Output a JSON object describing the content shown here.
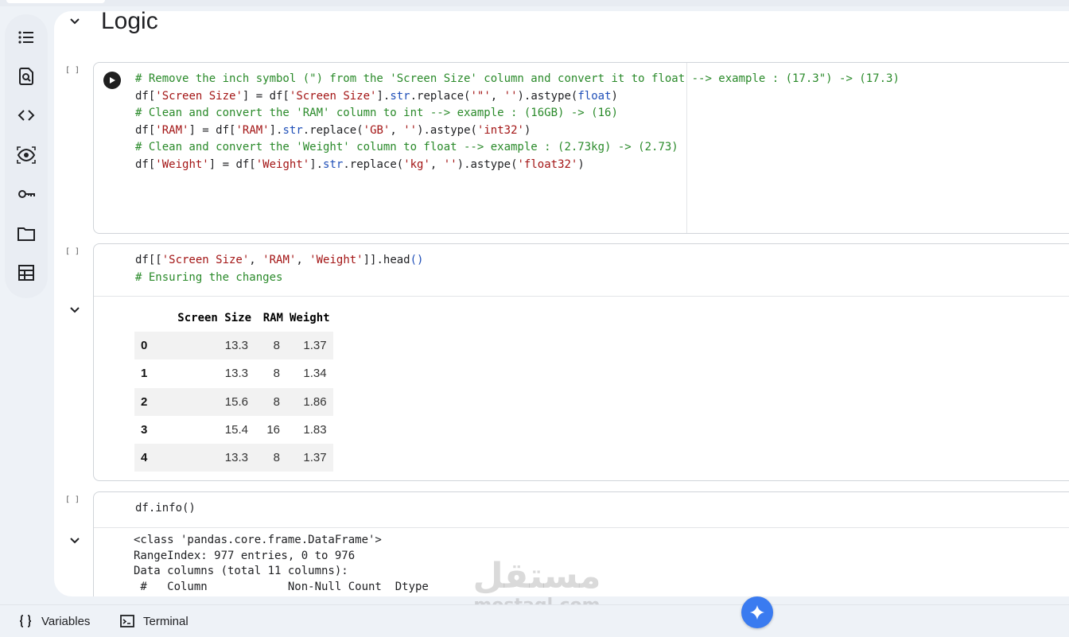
{
  "section": {
    "heading": "Logic"
  },
  "sidebar": {
    "items": [
      {
        "icon": "table-of-contents-icon"
      },
      {
        "icon": "find-icon"
      },
      {
        "icon": "code-snippets-icon"
      },
      {
        "icon": "variables-inspector-icon"
      },
      {
        "icon": "secrets-key-icon"
      },
      {
        "icon": "files-folder-icon"
      },
      {
        "icon": "data-table-icon"
      }
    ]
  },
  "cells": [
    {
      "exec_count": "[ ]",
      "code_lines": [
        "# Remove the inch symbol (\") from the 'Screen Size' column and convert it to float --> example : (17.3\") -> (17.3)",
        "df['Screen Size'] = df['Screen Size'].str.replace('\"', '').astype(float)",
        "",
        "# Clean and convert the 'RAM' column to int --> example : (16GB) -> (16)",
        "df['RAM'] = df['RAM'].str.replace('GB', '').astype('int32')",
        "",
        "# Clean and convert the 'Weight' column to float --> example : (2.73kg) -> (2.73)",
        "df['Weight'] = df['Weight'].str.replace('kg', '').astype('float32')"
      ]
    },
    {
      "exec_count": "[ ]",
      "code_lines": [
        "df[['Screen Size', 'RAM', 'Weight']].head()",
        "# Ensuring the changes"
      ],
      "output_table": {
        "columns": [
          "",
          "Screen Size",
          "RAM",
          "Weight"
        ],
        "rows": [
          [
            "0",
            "13.3",
            "8",
            "1.37"
          ],
          [
            "1",
            "13.3",
            "8",
            "1.34"
          ],
          [
            "2",
            "15.6",
            "8",
            "1.86"
          ],
          [
            "3",
            "15.4",
            "16",
            "1.83"
          ],
          [
            "4",
            "13.3",
            "8",
            "1.37"
          ]
        ]
      }
    },
    {
      "exec_count": "[ ]",
      "code_lines": [
        "df.info()"
      ],
      "output_lines": [
        "<class 'pandas.core.frame.DataFrame'>",
        "RangeIndex: 977 entries, 0 to 976",
        "Data columns (total 11 columns):",
        " #   Column            Non-Null Count  Dtype"
      ]
    }
  ],
  "bottombar": {
    "variables_label": "Variables",
    "terminal_label": "Terminal"
  },
  "watermark": {
    "arabic": "مستقل",
    "latin": "mostaql.com"
  },
  "colors": {
    "comment": "#2a8a2a",
    "string": "#a31515",
    "keyword": "#1f4fb8",
    "gemini": "#3a7bf0"
  }
}
